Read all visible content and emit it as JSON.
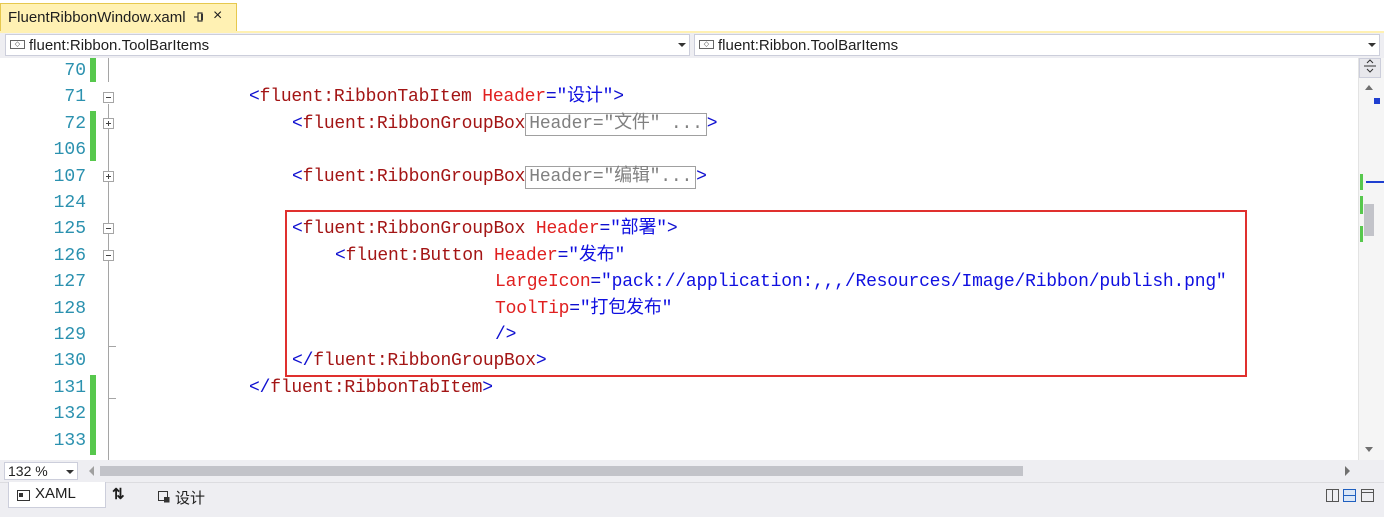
{
  "document_tab": {
    "title": "FluentRibbonWindow.xaml",
    "pin_glyph": "⊣",
    "close_glyph": "×"
  },
  "navigation": {
    "left_combo": "fluent:Ribbon.ToolBarItems",
    "right_combo": "fluent:Ribbon.ToolBarItems"
  },
  "editor": {
    "lines": [
      {
        "num": "70"
      },
      {
        "num": "71"
      },
      {
        "num": "72"
      },
      {
        "num": "106"
      },
      {
        "num": "107"
      },
      {
        "num": "124"
      },
      {
        "num": "125"
      },
      {
        "num": "126"
      },
      {
        "num": "127"
      },
      {
        "num": "128"
      },
      {
        "num": "129"
      },
      {
        "num": "130"
      },
      {
        "num": "131"
      },
      {
        "num": "132"
      },
      {
        "num": "133"
      }
    ],
    "code": {
      "l71": {
        "open": "<",
        "tag": "fluent:RibbonTabItem",
        "attr": " Header",
        "eq": "=",
        "val": "\"设计\"",
        "close": ">"
      },
      "l72": {
        "open": "<",
        "tag": "fluent:RibbonGroupBox",
        "collapsed": "Header=\"文件\" ...",
        "close": ">"
      },
      "l107": {
        "open": "<",
        "tag": "fluent:RibbonGroupBox",
        "collapsed": "Header=\"编辑\"...",
        "close": ">"
      },
      "l125": {
        "open": "<",
        "tag": "fluent:RibbonGroupBox",
        "attr": " Header",
        "eq": "=",
        "val": "\"部署\"",
        "close": ">"
      },
      "l126": {
        "open": "<",
        "tag": "fluent:Button",
        "attr": " Header",
        "eq": "=",
        "val": "\"发布\""
      },
      "l127": {
        "attr": "LargeIcon",
        "eq": "=",
        "val": "\"pack://application:,,,/Resources/Image/Ribbon/publish.png\""
      },
      "l128": {
        "attr": "ToolTip",
        "eq": "=",
        "val": "\"打包发布\""
      },
      "l129": {
        "selfclose": "/>"
      },
      "l130": {
        "open": "</",
        "tag": "fluent:RibbonGroupBox",
        "close": ">"
      },
      "l131": {
        "open": "</",
        "tag": "fluent:RibbonTabItem",
        "close": ">"
      }
    }
  },
  "status": {
    "zoom": "132 %"
  },
  "bottom_tabs": {
    "xaml": "XAML",
    "swap": "⇅",
    "design": "设计"
  },
  "colors": {
    "tab_active": "#fff1b3",
    "change_marker": "#57c84d",
    "highlight_box": "#e0302e",
    "line_number": "#2b91af",
    "xml_tag": "#a31515",
    "xml_attr": "#e02020",
    "xml_value": "#1010e0"
  }
}
